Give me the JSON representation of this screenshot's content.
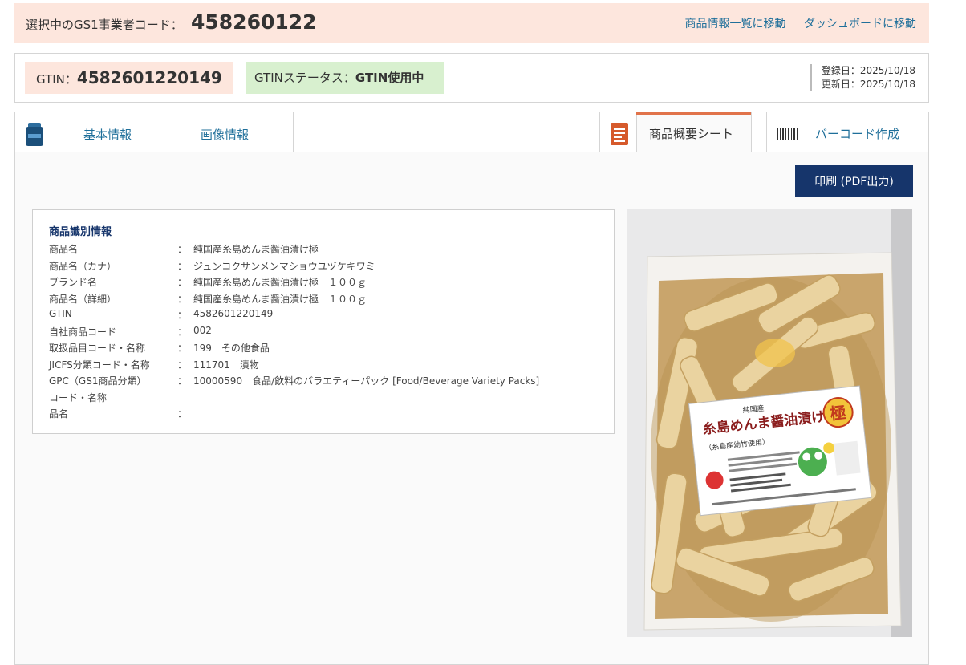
{
  "topbar": {
    "label": "選択中のGS1事業者コード：",
    "code": "458260122",
    "links": [
      "商品情報一覧に移動",
      "ダッシュボードに移動"
    ]
  },
  "gtin": {
    "label": "GTIN：",
    "value": "4582601220149",
    "status_label": "GTINステータス：",
    "status_value": "GTIN使用中",
    "registered": "登録日：2025/10/18",
    "updated": "更新日：2025/10/18"
  },
  "tabs": {
    "basic": "基本情報",
    "image": "画像情報",
    "sheet": "商品概要シート",
    "barcode": "バーコード作成"
  },
  "print_label": "印刷 (PDF出力)",
  "info": {
    "heading": "商品識別情報",
    "rows": [
      {
        "k": "商品名",
        "v": "純国産糸島めんま醤油漬け極"
      },
      {
        "k": "商品名（カナ）",
        "v": "ジュンコクサンメンマショウユヅケキワミ"
      },
      {
        "k": "ブランド名",
        "v": "純国産糸島めんま醤油漬け極　１００ｇ"
      },
      {
        "k": "商品名（詳細）",
        "v": "純国産糸島めんま醤油漬け極　１００ｇ"
      },
      {
        "k": "GTIN",
        "v": "4582601220149"
      },
      {
        "k": "自社商品コード",
        "v": "002"
      },
      {
        "k": "取扱品目コード・名称",
        "v": "199　その他食品"
      },
      {
        "k": "JICFS分類コード・名称",
        "v": "111701　漬物"
      },
      {
        "k": "GPC（GS1商品分類）",
        "v": "10000590　食品/飲料のバラエティーパック [Food/Beverage Variety Packs]"
      },
      {
        "k": "コード・名称",
        "v": ""
      },
      {
        "k": "品名",
        "v": ""
      }
    ]
  },
  "photo_label": {
    "line1": "純国産",
    "line2": "糸島めんま醤油漬け",
    "badge": "極",
    "line3": "（糸島産幼竹使用）"
  }
}
